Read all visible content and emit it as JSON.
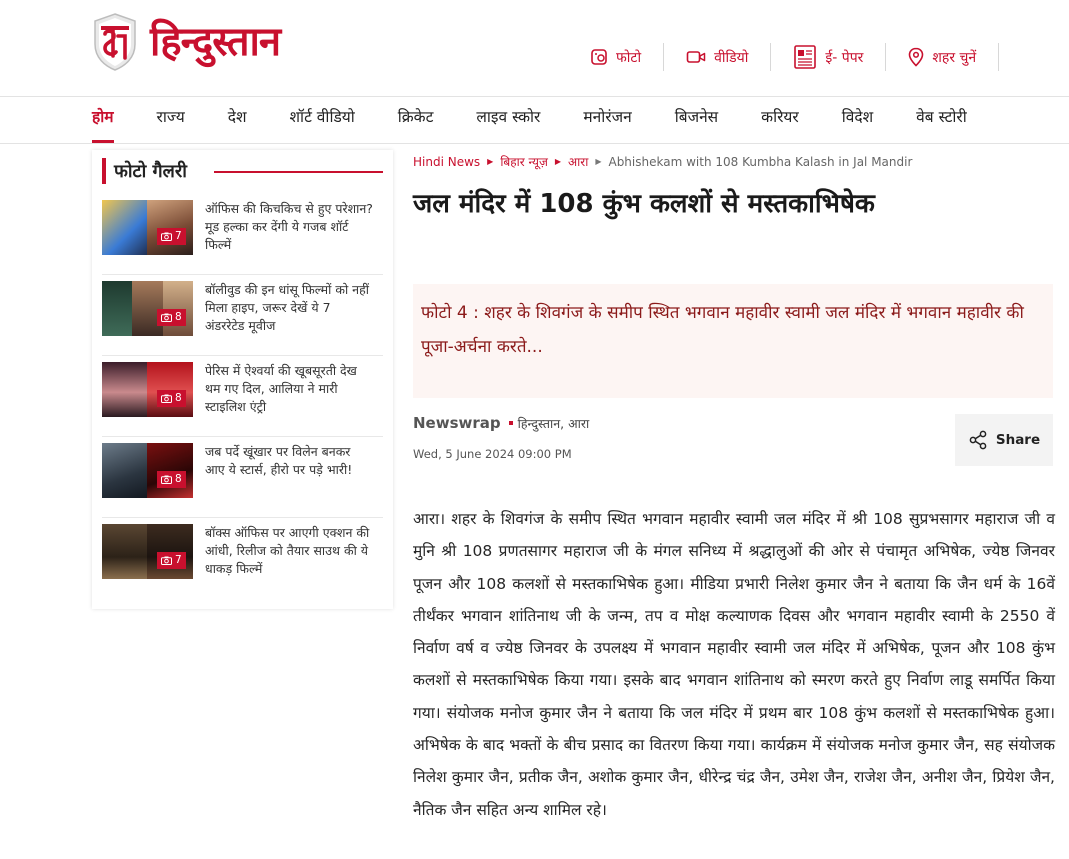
{
  "brand": {
    "name": "हिन्दुस्तान",
    "logo_icon": "hi-logo-shield",
    "accent": "#c8102e"
  },
  "utilities": [
    {
      "label": "फोटो",
      "icon": "photo-icon"
    },
    {
      "label": "वीडियो",
      "icon": "video-icon"
    },
    {
      "label": "ई- पेपर",
      "icon": "epaper-icon"
    },
    {
      "label": "शहर चुनें",
      "icon": "location-pin-icon"
    }
  ],
  "nav": [
    {
      "label": "होम",
      "active": true
    },
    {
      "label": "राज्य"
    },
    {
      "label": "देश"
    },
    {
      "label": "शॉर्ट वीडियो"
    },
    {
      "label": "क्रिकेट"
    },
    {
      "label": "लाइव स्कोर"
    },
    {
      "label": "मनोरंजन"
    },
    {
      "label": "बिजनेस"
    },
    {
      "label": "करियर"
    },
    {
      "label": "विदेश"
    },
    {
      "label": "वेब स्टोरी"
    }
  ],
  "gallery": {
    "title": "फोटो गैलरी",
    "items": [
      {
        "text": "ऑफिस की किचकिच से हुए परेशान? मूड हल्का कर देंगी ये गजब शॉर्ट फिल्में",
        "count": "7"
      },
      {
        "text": "बॉलीवुड की इन धांसू फिल्मों को नहीं मिला हाइप, जरूर देखें ये 7 अंडररेटेड मूवीज",
        "count": "8"
      },
      {
        "text": "पेरिस में ऐश्वर्या की खूबसूरती देख थम गए दिल, आलिया ने मारी स्टाइलिश एंट्री",
        "count": "8"
      },
      {
        "text": "जब पर्दे खूंखार पर विलेन बनकर आए ये स्टार्स, हीरो पर पड़े भारी!",
        "count": "8"
      },
      {
        "text": "बॉक्स ऑफिस पर आएगी एक्शन की आंधी, रिलीज को तैयार साउथ की ये धाकड़ फिल्में",
        "count": "7"
      }
    ]
  },
  "breadcrumb": {
    "home": "Hindi News",
    "state": "बिहार न्यूज़",
    "city": "आरा",
    "current": "Abhishekam with 108 Kumbha Kalash in Jal Mandir"
  },
  "article": {
    "title": "जल मंदिर में 108 कुंभ कलशों से मस्तकाभिषेक",
    "caption": "फोटो 4 : शहर के शिवगंज के समीप स्थित भगवान महावीर स्वामी जल मंदिर में भगवान महावीर की पूजा-अर्चना करते...",
    "author": "Newswrap",
    "source": "हिन्दुस्तान, आरा",
    "date": "Wed, 5 June 2024 09:00 PM",
    "share_label": "Share",
    "body": "आरा। शहर के शिवगंज के समीप स्थित भगवान महावीर स्वामी जल मंदिर में श्री 108 सुप्रभसागर महाराज जी व मुनि श्री 108 प्रणतसागर महाराज जी के मंगल सनिध्य में श्रद्धालुओं की ओर से पंचामृत अभिषेक, ज्येष्ठ जिनवर पूजन और 108 कलशों से मस्तकाभिषेक हुआ। मीडिया प्रभारी निलेश कुमार जैन ने बताया कि जैन धर्म के 16वें तीर्थंकर भगवान शांतिनाथ जी के जन्म, तप व मोक्ष कल्याणक दिवस और भगवान महावीर स्वामी के 2550 वें निर्वाण वर्ष व ज्येष्ठ जिनवर के उपलक्ष्य में भगवान महावीर स्वामी जल मंदिर में अभिषेक, पूजन और 108 कुंभ कलशों से मस्तकाभिषेक किया गया। इसके बाद भगवान शांतिनाथ को स्मरण करते हुए निर्वाण लाडू समर्पित किया गया। संयोजक मनोज कुमार जैन ने बताया कि जल मंदिर में प्रथम बार 108 कुंभ कलशों से मस्तकाभिषेक हुआ। अभिषेक के बाद भक्तों के बीच प्रसाद का वितरण किया गया। कार्यक्रम में संयोजक मनोज कुमार जैन, सह संयोजक निलेश कुमार जैन, प्रतीक जैन, अशोक कुमार जैन, धीरेन्द्र चंद्र जैन, उमेश जैन, राजेश जैन, अनीश जैन, प्रियेश जैन, नैतिक जैन सहित अन्य शामिल रहे।"
  }
}
